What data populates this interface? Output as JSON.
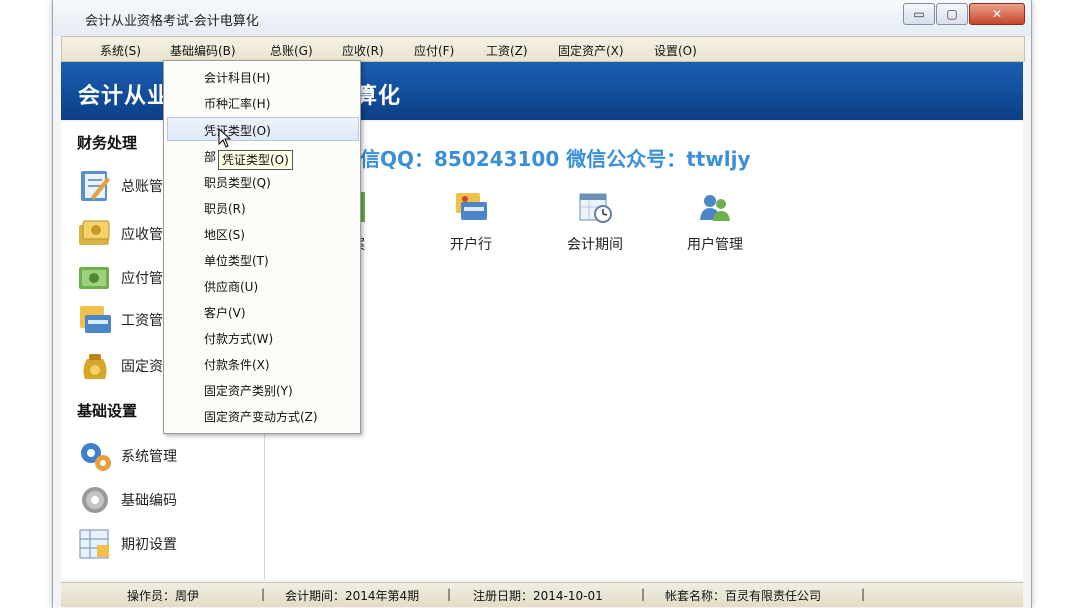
{
  "window": {
    "title": "会计从业资格考试-会计电算化",
    "min_symbol": "▭",
    "max_symbol": "▢",
    "close_symbol": "✕"
  },
  "menubar": {
    "items": [
      "系统(S)",
      "基础编码(B)",
      "总账(G)",
      "应收(R)",
      "应付(F)",
      "工资(Z)",
      "固定资产(X)",
      "设置(O)"
    ]
  },
  "banner": {
    "title_left": "会计从业",
    "title_right": "算化"
  },
  "watermark": "孙老师微信QQ：850243100   微信公众号：ttwljy",
  "sidebar": {
    "section1": "财务处理",
    "items1": [
      "总账管",
      "应收管",
      "应付管",
      "工资管",
      "固定资"
    ],
    "section2": "基础设置",
    "items2": [
      "系统管理",
      "基础编码",
      "期初设置"
    ]
  },
  "tiles": [
    "档案",
    "开户行",
    "会计期间",
    "用户管理"
  ],
  "dropdown": {
    "items": [
      "会计科目(H)",
      "币种汇率(H)",
      "凭证类型(O)",
      "部",
      "职员类型(Q)",
      "职员(R)",
      "地区(S)",
      "单位类型(T)",
      "供应商(U)",
      "客户(V)",
      "付款方式(W)",
      "付款条件(X)",
      "固定资产类别(Y)",
      "固定资产变动方式(Z)"
    ],
    "highlighted_index": 2,
    "tooltip": "凭证类型(O)"
  },
  "status": {
    "operator": "操作员：周伊",
    "period": "会计期间：2014年第4期",
    "reg_date": "注册日期：2014-10-01",
    "account": "帐套名称：百灵有限责任公司",
    "sep": "|"
  },
  "colors": {
    "banner": "#0c3f86",
    "watermark": "#3a8fd8",
    "accent": "#1a5fb3"
  }
}
